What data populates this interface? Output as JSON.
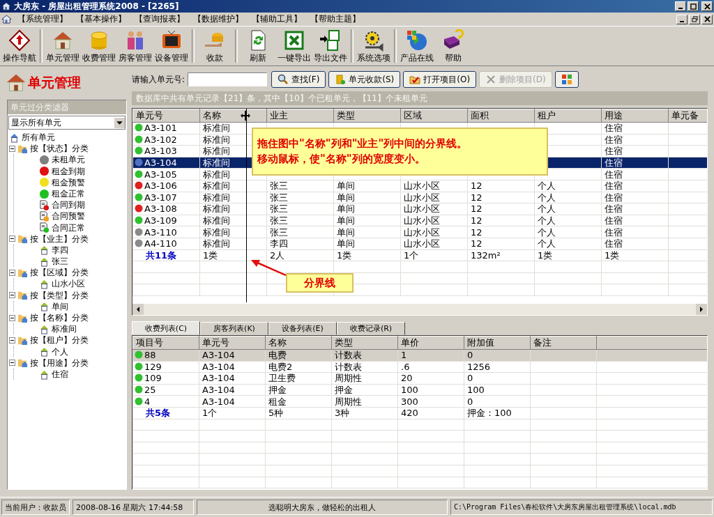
{
  "window": {
    "title": "大房东 - 房屋出租管理系统2008 - [2265]"
  },
  "menu": [
    "【系统管理】",
    "【基本操作】",
    "【查询报表】",
    "【数据维护】",
    "【辅助工具】",
    "【帮助主题】"
  ],
  "toolbar": [
    [
      {
        "label": "操作导航",
        "kind": "nav"
      }
    ],
    [
      {
        "label": "单元管理",
        "kind": "house"
      },
      {
        "label": "收费管理",
        "kind": "coins"
      },
      {
        "label": "房客管理",
        "kind": "people"
      },
      {
        "label": "设备管理",
        "kind": "tv"
      }
    ],
    [
      {
        "label": "收款",
        "kind": "cash"
      }
    ],
    [
      {
        "label": "刷新",
        "kind": "refresh"
      },
      {
        "label": "一键导出",
        "kind": "excel"
      },
      {
        "label": "导出文件",
        "kind": "export"
      }
    ],
    [
      {
        "label": "系统选项",
        "kind": "gear"
      }
    ],
    [
      {
        "label": "产品在线",
        "kind": "globe"
      },
      {
        "label": "帮助",
        "kind": "help"
      }
    ]
  ],
  "panel": {
    "title": "单元管理",
    "filter_title": "单元过分类滤器",
    "filter_value": "显示所有单元",
    "tree": [
      {
        "label": "所有单元",
        "kind": "house"
      },
      {
        "label": "按【状态】分类",
        "kind": "folder",
        "expanded": true,
        "children": [
          {
            "label": "未租单元",
            "kind": "dot",
            "color": "#808080"
          },
          {
            "label": "租金到期",
            "kind": "dot",
            "color": "#e01010"
          },
          {
            "label": "租金预警",
            "kind": "dot",
            "color": "#f0e020"
          },
          {
            "label": "租金正常",
            "kind": "dot",
            "color": "#20c020"
          },
          {
            "label": "合同到期",
            "kind": "doc",
            "color": "#e01010"
          },
          {
            "label": "合同预警",
            "kind": "doc",
            "color": "#f0a020"
          },
          {
            "label": "合同正常",
            "kind": "doc",
            "color": "#20c020"
          }
        ]
      },
      {
        "label": "按【业主】分类",
        "kind": "folder",
        "expanded": true,
        "children": [
          {
            "label": "李四",
            "kind": "house"
          },
          {
            "label": "张三",
            "kind": "house"
          }
        ]
      },
      {
        "label": "按【区域】分类",
        "kind": "folder",
        "expanded": true,
        "children": [
          {
            "label": "山水小区",
            "kind": "house"
          }
        ]
      },
      {
        "label": "按【类型】分类",
        "kind": "folder",
        "expanded": true,
        "children": [
          {
            "label": "单间",
            "kind": "house"
          }
        ]
      },
      {
        "label": "按【名称】分类",
        "kind": "folder",
        "expanded": true,
        "children": [
          {
            "label": "标准间",
            "kind": "house"
          }
        ]
      },
      {
        "label": "按【租户】分类",
        "kind": "folder",
        "expanded": true,
        "children": [
          {
            "label": "个人",
            "kind": "house"
          }
        ]
      },
      {
        "label": "按【用途】分类",
        "kind": "folder",
        "expanded": true,
        "children": [
          {
            "label": "住宿",
            "kind": "house"
          }
        ]
      }
    ]
  },
  "search": {
    "label": "请输入单元号:",
    "buttons": [
      {
        "label": "查找(F)",
        "kind": "search",
        "disabled": false
      },
      {
        "label": "单元收款(S)",
        "kind": "coins",
        "disabled": false
      },
      {
        "label": "打开项目(O)",
        "kind": "open",
        "disabled": false
      },
      {
        "label": "删除项目(D)",
        "kind": "delete",
        "disabled": true
      },
      {
        "kind": "grid",
        "disabled": false
      }
    ]
  },
  "info": "数据库中共有单元记录【21】条，其中【10】个已租单元，【11】个未租单元",
  "units": {
    "columns": [
      "单元号",
      "名称",
      "业主",
      "类型",
      "区域",
      "面积",
      "租户",
      "用途",
      "单元备"
    ],
    "rows": [
      {
        "color": "#30c030",
        "selected": false,
        "cells": [
          "A3-101",
          "标准间",
          null,
          null,
          null,
          null,
          null,
          "住宿"
        ]
      },
      {
        "color": "#30c030",
        "selected": false,
        "cells": [
          "A3-102",
          "标准间",
          null,
          null,
          null,
          null,
          null,
          "住宿"
        ]
      },
      {
        "color": "#30c030",
        "selected": false,
        "cells": [
          "A3-103",
          "标准间",
          null,
          null,
          null,
          null,
          null,
          "住宿"
        ]
      },
      {
        "color": "#5070c0",
        "selected": true,
        "cells": [
          "A3-104",
          "标准间",
          null,
          null,
          null,
          null,
          null,
          "住宿"
        ]
      },
      {
        "color": "#30c030",
        "selected": false,
        "cells": [
          "A3-105",
          "标准间",
          null,
          null,
          null,
          null,
          null,
          "住宿"
        ]
      },
      {
        "color": "#e02020",
        "selected": false,
        "cells": [
          "A3-106",
          "标准间",
          "张三",
          "单间",
          "山水小区",
          "12",
          "个人",
          "住宿"
        ]
      },
      {
        "color": "#30c030",
        "selected": false,
        "cells": [
          "A3-107",
          "标准间",
          "张三",
          "单间",
          "山水小区",
          "12",
          "个人",
          "住宿"
        ]
      },
      {
        "color": "#e02020",
        "selected": false,
        "cells": [
          "A3-108",
          "标准间",
          "张三",
          "单间",
          "山水小区",
          "12",
          "个人",
          "住宿"
        ]
      },
      {
        "color": "#30c030",
        "selected": false,
        "cells": [
          "A3-109",
          "标准间",
          "张三",
          "单间",
          "山水小区",
          "12",
          "个人",
          "住宿"
        ]
      },
      {
        "color": "#8a8a8a",
        "selected": false,
        "cells": [
          "A3-110",
          "标准间",
          "张三",
          "单间",
          "山水小区",
          "12",
          "个人",
          "住宿"
        ]
      },
      {
        "color": "#8a8a8a",
        "selected": false,
        "cells": [
          "A4-110",
          "标准间",
          "李四",
          "单间",
          "山水小区",
          "12",
          "个人",
          "住宿"
        ]
      }
    ],
    "summary": [
      "共11条",
      "1类",
      "2人",
      "1类",
      "1个",
      "132m²",
      "1类",
      "1类"
    ]
  },
  "callout": {
    "lines": [
      "拖住图中\"名称\"列和\"业主\"列中间的分界线。",
      "移动鼠标，使\"名称\"列的宽度变小。"
    ],
    "label": "分界线"
  },
  "tabs": [
    {
      "label": "收费列表(C)",
      "selected": true
    },
    {
      "label": "房客列表(K)",
      "selected": false
    },
    {
      "label": "设备列表(E)",
      "selected": false
    },
    {
      "label": "收费记录(R)",
      "selected": false
    }
  ],
  "items": {
    "columns": [
      "项目号",
      "单元号",
      "名称",
      "类型",
      "单价",
      "附加值",
      "备注"
    ],
    "rows": [
      {
        "selected": true,
        "cells": [
          "88",
          "A3-104",
          "电费",
          "计数表",
          "1",
          "0"
        ]
      },
      {
        "selected": false,
        "cells": [
          "129",
          "A3-104",
          "电费2",
          "计数表",
          ".6",
          "1256"
        ]
      },
      {
        "selected": false,
        "cells": [
          "109",
          "A3-104",
          "卫生费",
          "周期性",
          "20",
          "0"
        ]
      },
      {
        "selected": false,
        "cells": [
          "25",
          "A3-104",
          "押金",
          "押金",
          "100",
          "100"
        ]
      },
      {
        "selected": false,
        "cells": [
          "4",
          "A3-104",
          "租金",
          "周期性",
          "300",
          "0"
        ]
      }
    ],
    "summary": [
      "共5条",
      "1个",
      "5种",
      "3种",
      "420",
      "押金：100"
    ]
  },
  "status_bar": [
    "当前用户：收款员",
    "2008-08-16 星期六 17:44:58",
    "选聪明大房东，做轻松的出租人",
    "C:\\Program Files\\春松软件\\大房东房屋出租管理系统\\local.mdb"
  ]
}
